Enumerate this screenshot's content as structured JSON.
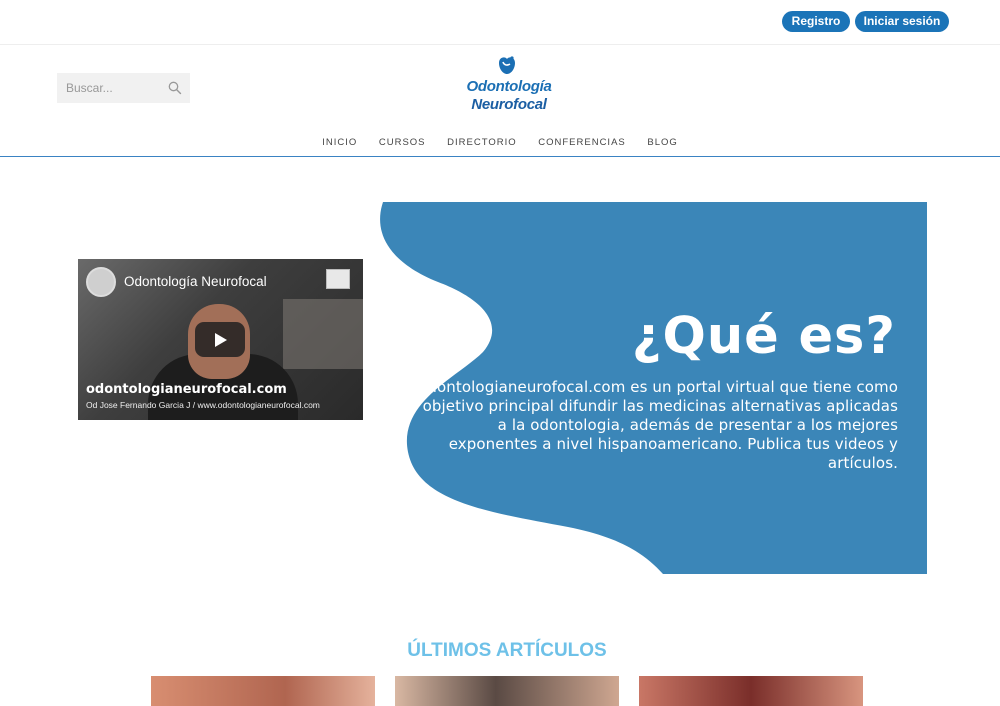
{
  "auth": {
    "register_label": "Registro",
    "login_label": "Iniciar sesión"
  },
  "search": {
    "placeholder": "Buscar..."
  },
  "logo": {
    "line1": "Odontología",
    "line2": "Neurofocal"
  },
  "nav": {
    "items": [
      "INICIO",
      "CURSOS",
      "DIRECTORIO",
      "CONFERENCIAS",
      "BLOG"
    ]
  },
  "video": {
    "title": "Odontología Neurofocal",
    "url_big": "odontologianeurofocal.com",
    "url_small": "Od Jose Fernando Garcia J / www.odontologianeurofocal.com"
  },
  "hero": {
    "title": "¿Qué es?",
    "text": "odontologianeurofocal.com es un portal virtual que tiene como objetivo principal difundir las medicinas alternativas aplicadas a la odontologia, además de presentar a los mejores exponentes a nivel hispanoamericano. Publica tus videos y artículos."
  },
  "articles": {
    "title": "ÚLTIMOS ARTÍCULOS"
  },
  "colors": {
    "brand": "#1b74b8",
    "hero_bg": "#3b86b8",
    "section_title": "#6ec1e8"
  }
}
